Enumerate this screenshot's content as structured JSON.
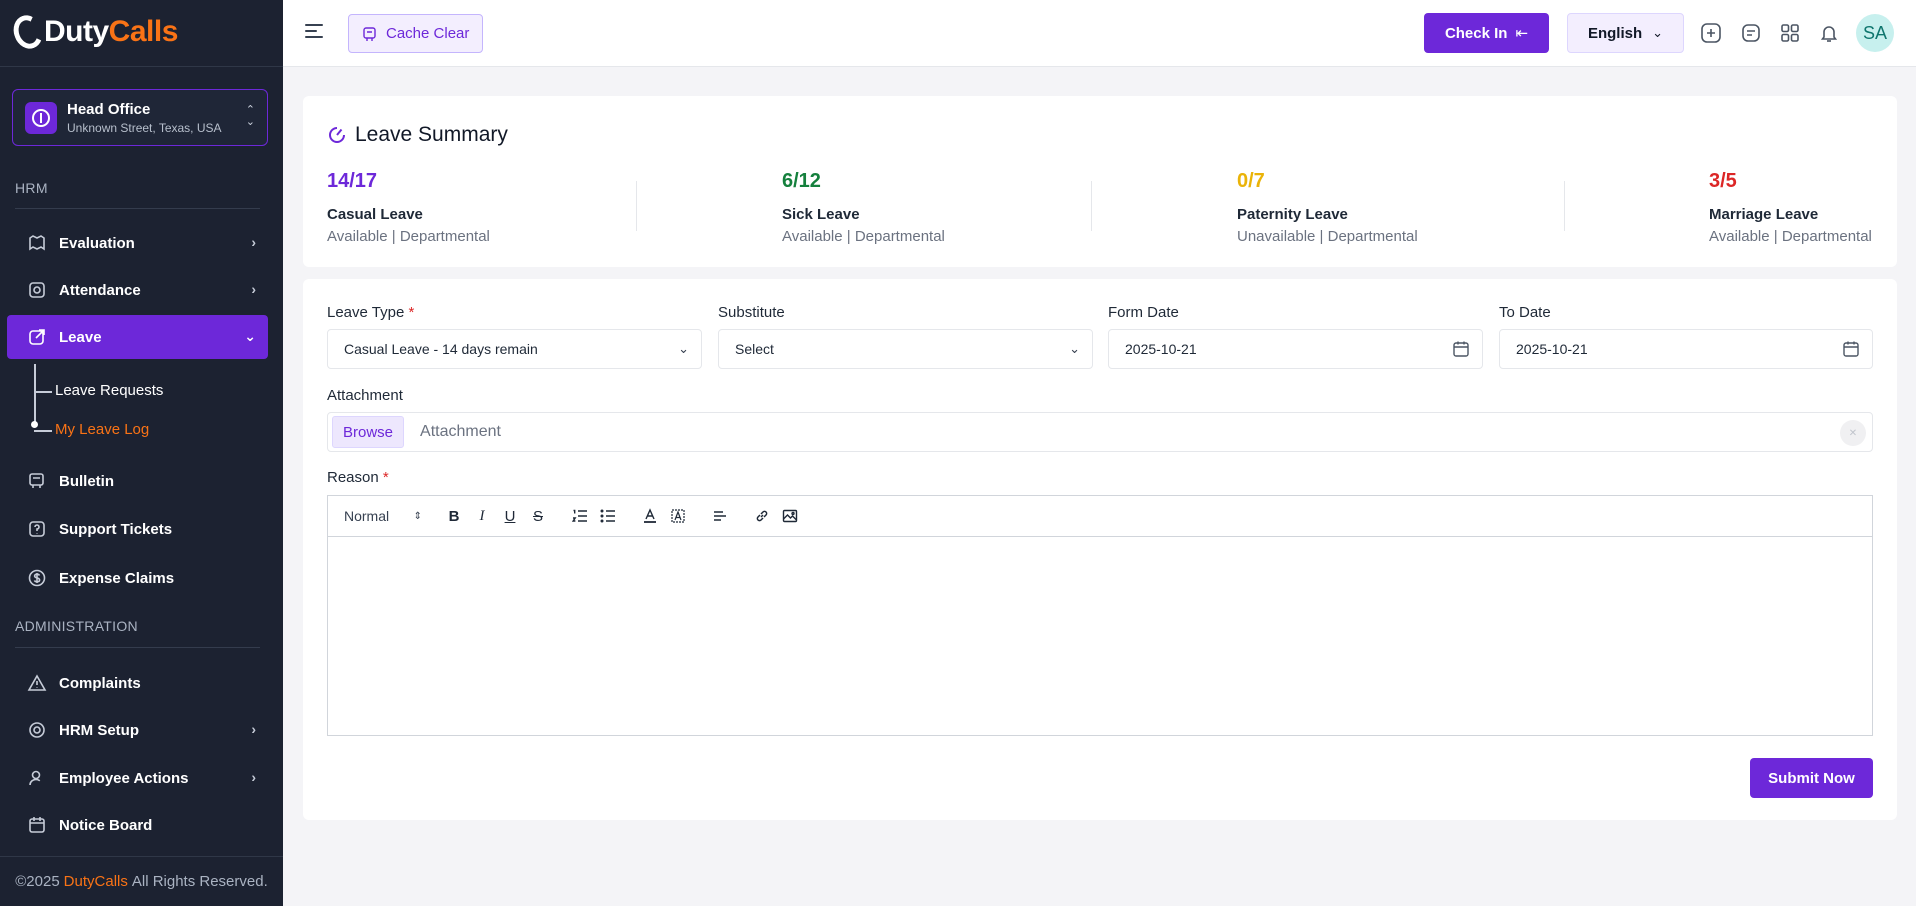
{
  "brand": {
    "duty": "Duty",
    "calls": "Calls",
    "accent": "#f97316",
    "primary": "#6d28d9"
  },
  "branch": {
    "name": "Head Office",
    "address": "Unknown Street, Texas, USA"
  },
  "sidebar": {
    "section_hrm": "HRM",
    "section_admin": "ADMINISTRATION",
    "items": [
      {
        "label": "Evaluation",
        "icon": "evaluation-icon"
      },
      {
        "label": "Attendance",
        "icon": "attendance-icon"
      },
      {
        "label": "Leave",
        "icon": "leave-icon"
      },
      {
        "label": "Bulletin",
        "icon": "bulletin-icon"
      },
      {
        "label": "Support Tickets",
        "icon": "support-icon"
      },
      {
        "label": "Expense Claims",
        "icon": "dollar-icon"
      },
      {
        "label": "Complaints",
        "icon": "warning-icon"
      },
      {
        "label": "HRM Setup",
        "icon": "gear-icon"
      },
      {
        "label": "Employee Actions",
        "icon": "user-icon"
      },
      {
        "label": "Notice Board",
        "icon": "calendar-icon"
      }
    ],
    "leave_sub": [
      "Leave Requests",
      "My Leave Log"
    ]
  },
  "footer": {
    "prefix": "©2025",
    "brand": "DutyCalls",
    "suffix": "All Rights Reserved."
  },
  "topbar": {
    "cache_clear": "Cache Clear",
    "check_in": "Check In",
    "language": "English",
    "avatar": "SA"
  },
  "summary": {
    "title": "Leave Summary",
    "stats": [
      {
        "value": "14/17",
        "name": "Casual Leave",
        "meta": "Available | Departmental",
        "color": "#6d28d9"
      },
      {
        "value": "6/12",
        "name": "Sick Leave",
        "meta": "Available | Departmental",
        "color": "#15803d"
      },
      {
        "value": "0/7",
        "name": "Paternity Leave",
        "meta": "Unavailable | Departmental",
        "color": "#eab308"
      },
      {
        "value": "3/5",
        "name": "Marriage Leave",
        "meta": "Available | Departmental",
        "color": "#dc2626"
      }
    ]
  },
  "form": {
    "leave_type_label": "Leave Type",
    "leave_type_value": "Casual Leave - 14 days remain",
    "substitute_label": "Substitute",
    "substitute_value": "Select",
    "from_date_label": "Form Date",
    "from_date_value": "2025-10-21",
    "to_date_label": "To Date",
    "to_date_value": "2025-10-21",
    "attachment_label": "Attachment",
    "browse": "Browse",
    "attachment_placeholder": "Attachment",
    "reason_label": "Reason",
    "editor_format": "Normal",
    "submit": "Submit Now",
    "required_mark": "*"
  }
}
